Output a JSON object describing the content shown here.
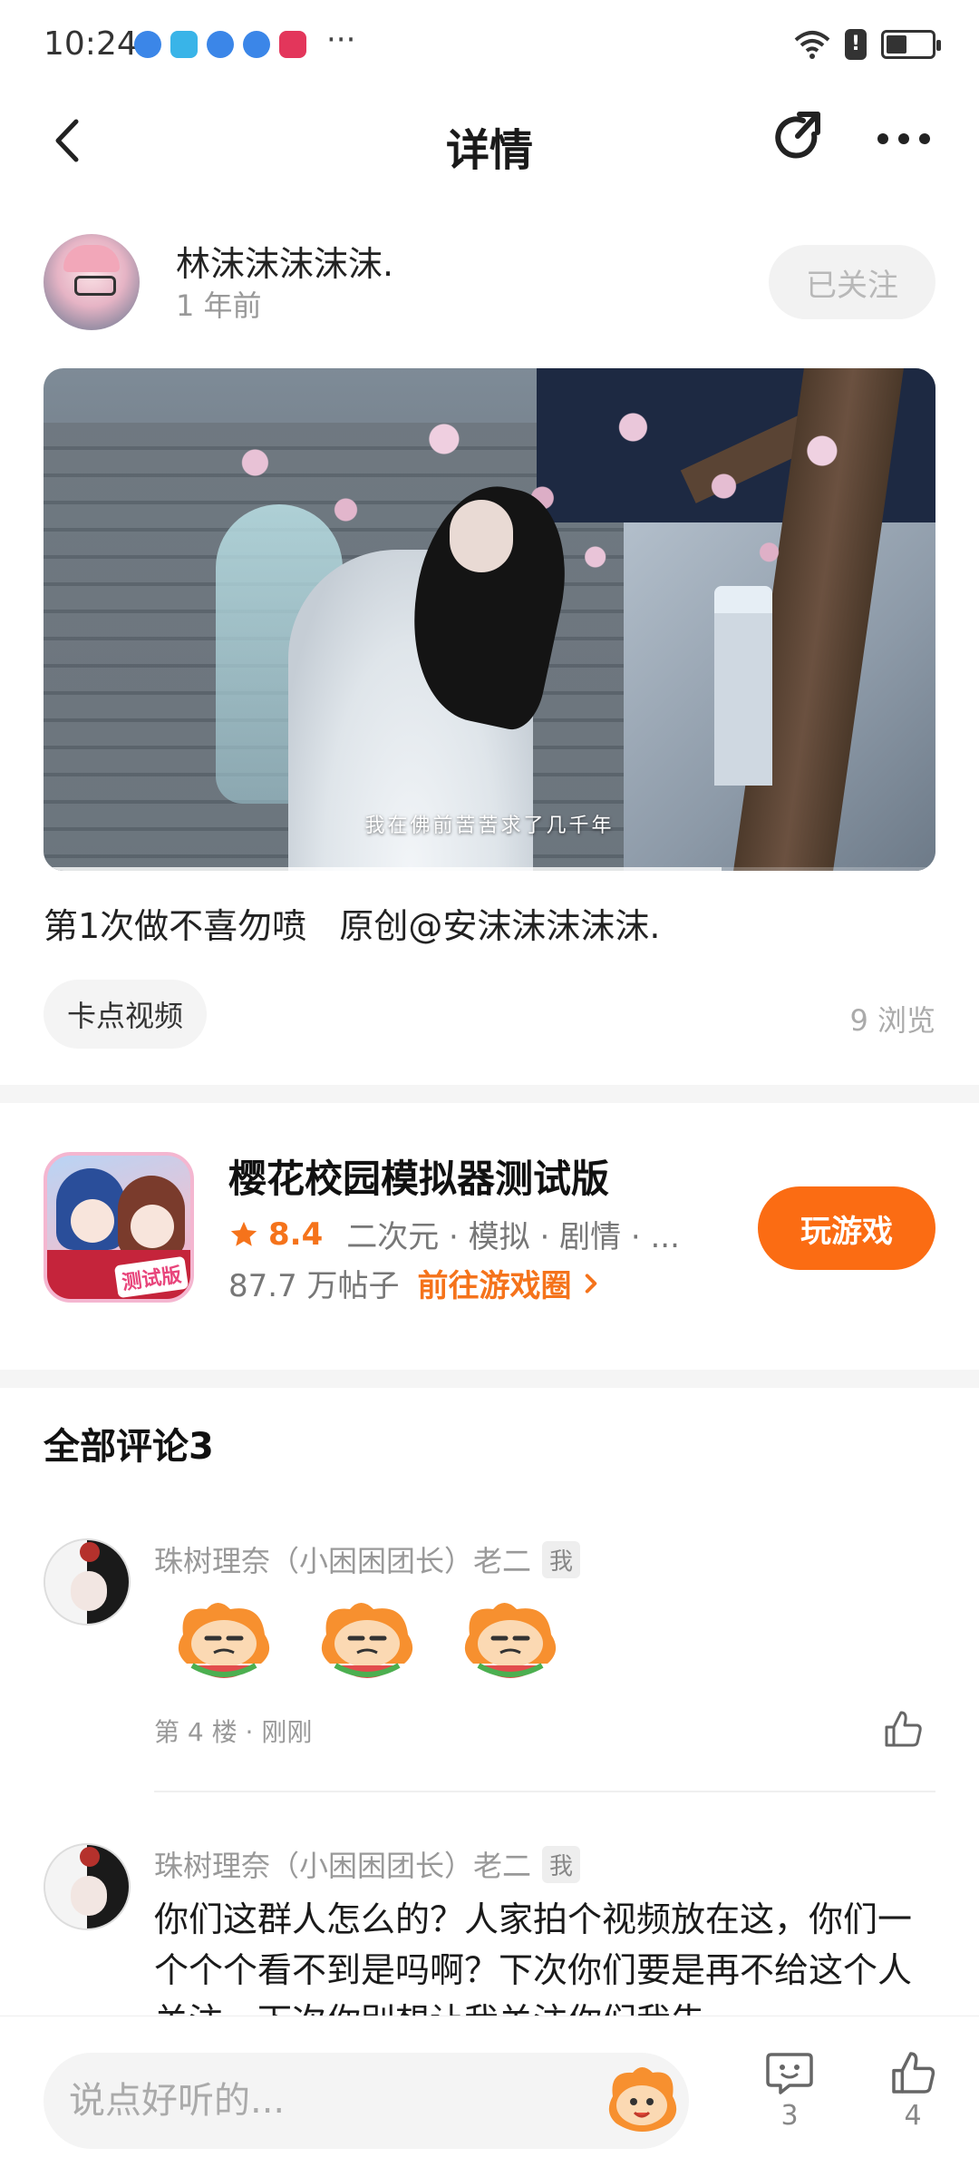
{
  "status_bar": {
    "time": "10:24",
    "more": "···",
    "app_icon_colors": [
      "#3b86e8",
      "#39b4e8",
      "#3b86e8",
      "#3b86e8",
      "#e3365b"
    ],
    "alert": "!"
  },
  "header": {
    "title": "详情"
  },
  "post": {
    "author": "林沫沫沫沫沫.",
    "time": "1 年前",
    "follow_label": "已关注",
    "video_subtitle": "我在佛前苦苦求了几千年",
    "video_progress": 0.76,
    "text": "第1次做不喜勿喷   原创@安沫沫沫沫沫.",
    "tag": "卡点视频",
    "views": "9 浏览"
  },
  "game": {
    "name": "樱花校园模拟器测试版",
    "rating": "8.4",
    "tags": "二次元 · 模拟 · 剧情 · ...",
    "posts": "87.7 万帖子",
    "goto_label": "前往游戏圈",
    "icon_badge": "测试版",
    "play_label": "玩游戏",
    "accent_color": "#fb6c13"
  },
  "comments": {
    "title": "全部评论3",
    "items": [
      {
        "user": "珠树理奈（小困困团长）老二",
        "badge": "我",
        "meta": "第 4 楼 · 刚刚",
        "emoji_count": 3
      },
      {
        "user": "珠树理奈（小困困团长）老二",
        "badge": "我",
        "text": "你们这群人怎么的？人家拍个视频放在这，你们一个个个看不到是吗啊？下次你们要是再不给这个人关注，下次你别想让我关注你们我告"
      }
    ]
  },
  "bottom_bar": {
    "placeholder": "说点好听的...",
    "comment_count": "3",
    "like_count": "4"
  }
}
